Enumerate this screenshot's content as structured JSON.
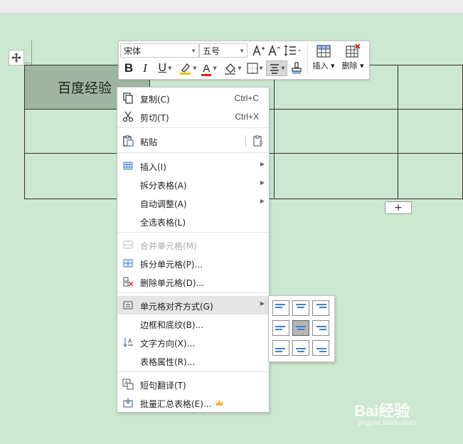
{
  "document": {
    "selected_cell_text": "百度经验",
    "add_row_label": "+"
  },
  "toolbar": {
    "font_family": "宋体",
    "font_size": "五号",
    "bold": "B",
    "italic": "I",
    "underline": "U",
    "font_color_letter": "A",
    "insert_label": "插入",
    "delete_label": "删除"
  },
  "context_menu": {
    "copy": {
      "label": "复制(C)",
      "shortcut": "Ctrl+C"
    },
    "cut": {
      "label": "剪切(T)",
      "shortcut": "Ctrl+X"
    },
    "paste": {
      "label": "粘贴"
    },
    "insert": {
      "label": "插入(I)"
    },
    "split_table": {
      "label": "拆分表格(A)"
    },
    "auto_fit": {
      "label": "自动调整(A)"
    },
    "select_table": {
      "label": "全选表格(L)"
    },
    "merge_cells": {
      "label": "合并单元格(M)"
    },
    "split_cells": {
      "label": "拆分单元格(P)..."
    },
    "delete_cells": {
      "label": "删除单元格(D)..."
    },
    "cell_alignment": {
      "label": "单元格对齐方式(G)"
    },
    "borders_shading": {
      "label": "边框和底纹(B)..."
    },
    "text_direction": {
      "label": "文字方向(X)..."
    },
    "table_properties": {
      "label": "表格属性(R)..."
    },
    "translate": {
      "label": "短句翻译(T)"
    },
    "batch_summary": {
      "label": "批量汇总表格(E)..."
    }
  },
  "watermark": {
    "main": "Bai经验",
    "sub": "jingyan.baidu.com"
  },
  "colors": {
    "background": "#cce8d0",
    "selected_cell": "#9fb5a2",
    "accent_blue": "#3d7fd6",
    "highlight_yellow": "#f2c200",
    "font_red": "#e02020"
  }
}
